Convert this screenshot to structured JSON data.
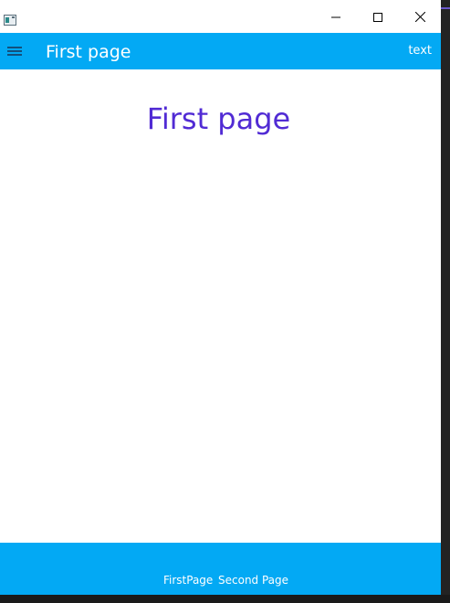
{
  "titlebar": {
    "icons": {
      "app": "app-window-icon",
      "minimize": "minimize-icon",
      "maximize": "maximize-icon",
      "close": "close-icon"
    }
  },
  "appbar": {
    "menu_icon": "hamburger-menu-icon",
    "title": "First page",
    "action_label": "text",
    "background": "#03a9f4"
  },
  "content": {
    "heading": "First page",
    "heading_color": "#512bd4"
  },
  "tabbar": {
    "background": "#03a9f4",
    "tabs": [
      {
        "label": "FirstPage"
      },
      {
        "label": "Second Page"
      }
    ]
  }
}
